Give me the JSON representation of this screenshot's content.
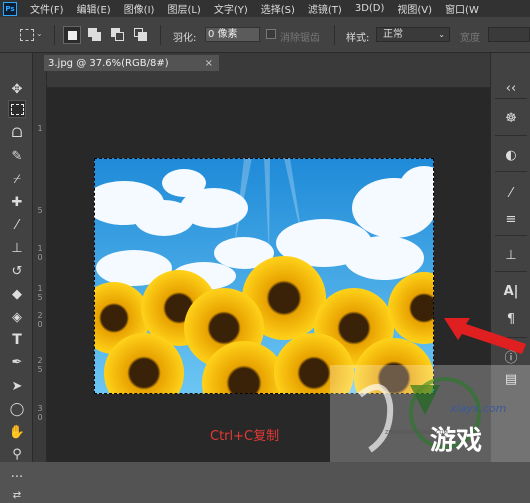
{
  "menubar": {
    "app_icon": "Ps",
    "items": [
      "文件(F)",
      "编辑(E)",
      "图像(I)",
      "图层(L)",
      "文字(Y)",
      "选择(S)",
      "滤镜(T)",
      "3D(D)",
      "视图(V)",
      "窗口(W"
    ]
  },
  "options": {
    "feather_label": "羽化:",
    "feather_value": "0 像素",
    "antialias_label": "消除锯齿",
    "style_label": "样式:",
    "style_value": "正常",
    "width_label": "宽度"
  },
  "document": {
    "tab_title": "3.jpg @ 37.6%(RGB/8#)",
    "tab_close": "×"
  },
  "ruler": {
    "vertical_ticks": [
      "1",
      "5",
      "1\n0",
      "1\n5",
      "2\n0",
      "2\n5",
      "3\n0"
    ]
  },
  "toolbar": {
    "tools": [
      "move-icon",
      "rect-marquee-icon",
      "lasso-icon",
      "quick-select-icon",
      "eyedropper-icon",
      "healing-brush-icon",
      "brush-icon",
      "clone-stamp-icon",
      "history-brush-icon",
      "eraser-icon",
      "paint-bucket-icon",
      "blur-icon",
      "dodge-icon",
      "pen-icon",
      "type-icon",
      "path-select-icon",
      "shape-icon",
      "hand-icon",
      "zoom-icon",
      "more-icon",
      "swap-colors-icon"
    ]
  },
  "caption": "Ctrl+C复制",
  "watermark": {
    "text": "游戏",
    "url": "xiayx.com",
    "small": "ZHONGYOUXIWANG.COM"
  },
  "colors": {
    "menubar_bg": "#323232",
    "panel_bg": "#424242",
    "canvas_bg": "#282828",
    "caption": "#e53935",
    "arrow": "#e02020",
    "sky": "#38a8e8",
    "sunflower": "#ffc20e"
  }
}
